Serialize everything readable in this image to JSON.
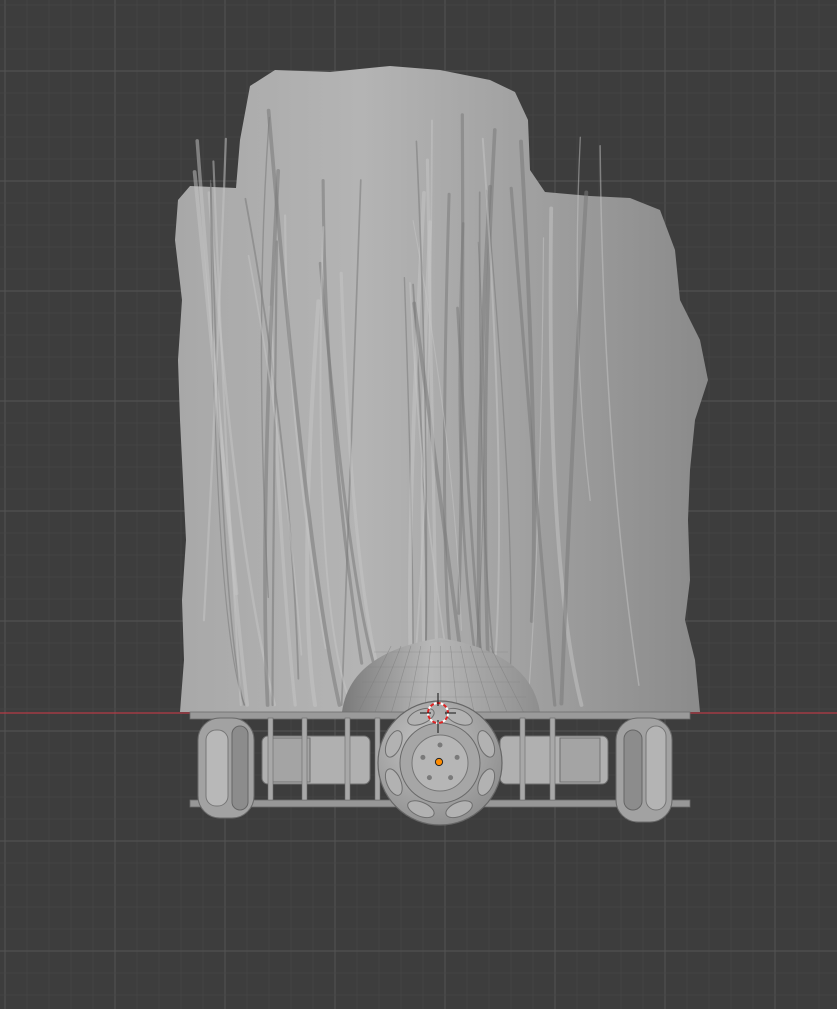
{
  "viewport": {
    "background": "#3d3d3d",
    "grid_minor_color": "#464646",
    "grid_major_color": "#515151",
    "x_axis_color": "#b53b45",
    "mesh_color": "#9c9c9c",
    "mesh_highlight": "#bdbdbd",
    "mesh_shadow": "#6a6a6a",
    "origin_color": "#ff8c00"
  },
  "objects": {
    "trunk": {
      "name": "tree-trunk-mesh"
    },
    "dome": {
      "name": "dome-mesh"
    },
    "robot": {
      "name": "omni-wheel-robot-base"
    },
    "cursor": {
      "name": "3d-cursor-icon"
    },
    "origin": {
      "name": "object-origin-icon"
    }
  }
}
